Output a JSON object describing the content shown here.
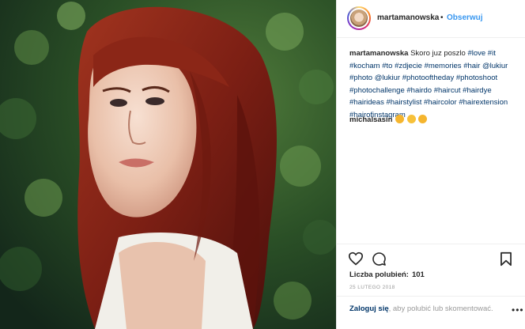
{
  "header": {
    "username": "martamanowska",
    "separator": "•",
    "follow_label": "Obserwuj"
  },
  "caption": {
    "username": "martamanowska",
    "text": "Skoro juz poszlo",
    "tags": [
      "#love",
      "#it",
      "#kocham",
      "#to",
      "#zdjecie",
      "#memories",
      "#hair",
      "@lukiur",
      "#photo",
      "@lukiur",
      "#photooftheday",
      "#photoshoot",
      "#photochallenge",
      "#hairdo",
      "#haircut",
      "#hairdye",
      "#hairideas",
      "#hairstylist",
      "#haircolor",
      "#hairextension",
      "#hairofinstagram"
    ]
  },
  "comments": [
    {
      "username": "michalsasin",
      "emojis": [
        "clapping-hands-emoji",
        "flexed-biceps-emoji",
        "heart-eyes-emoji"
      ]
    }
  ],
  "likes": {
    "label": "Liczba polubień:",
    "count": "101"
  },
  "date": "25 LUTEGO 2018",
  "login": {
    "link": "Zaloguj się",
    "text": ", aby polubić lub skomentować."
  },
  "icons": [
    "heart-icon",
    "comment-icon",
    "bookmark-icon",
    "more-options-icon"
  ],
  "colors": {
    "link_blue": "#3897f0",
    "tag_blue": "#003569",
    "muted": "#999999"
  }
}
